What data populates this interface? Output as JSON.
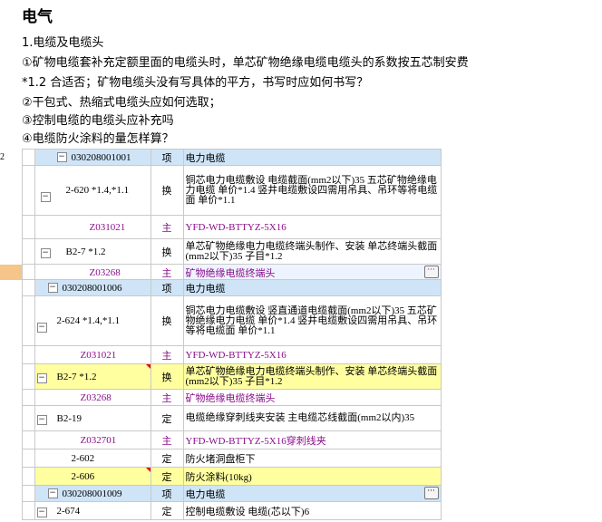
{
  "heading": "电气",
  "lines": [
    "1.电缆及电缆头",
    "①矿物电缆套补充定额里面的电缆头时，单芯矿物绝缘电缆电缆头的系数按五芯制安费",
    "*1.2 合适否；矿物电缆头没有写具体的平方，书写时应如何书写？",
    "②干包式、热缩式电缆头应如何选取；",
    "③控制电缆的电缆头应补充吗",
    "④电缆防火涂料的量怎样算？"
  ],
  "table1": {
    "left_mark": "2",
    "rows": [
      {
        "code": "030208001001",
        "type": "项",
        "desc": "电力电缆"
      },
      {
        "code": "2-620 *1.4,*1.1",
        "type": "换",
        "desc": "铜芯电力电缆敷设 电缆截面(mm2以下)35 五芯矿物绝缘电力电缆 单价*1.4 竖井电缆敷设四需用吊具、吊环等将电缆面 单价*1.1"
      },
      {
        "code": "Z031021",
        "type": "主",
        "desc": "YFD-WD-BTTYZ-5X16"
      },
      {
        "code": "B2-7 *1.2",
        "type": "换",
        "desc": "单芯矿物绝缘电力电缆终端头制作、安装 单芯终端头截面(mm2以下)35 子目*1.2"
      },
      {
        "code": "Z03268",
        "type": "主",
        "desc": "矿物绝缘电缆终端头"
      }
    ]
  },
  "table2": {
    "rows": [
      {
        "code": "030208001006",
        "type": "项",
        "desc": "电力电缆"
      },
      {
        "code": "2-624 *1.4,*1.1",
        "type": "换",
        "desc": "铜芯电力电缆敷设 竖直通道电缆截面(mm2以下)35 五芯矿物绝缘电力电缆 单价*1.4 竖井电缆敷设四需用吊具、吊环等将电缆面 单价*1.1"
      },
      {
        "code": "Z031021",
        "type": "主",
        "desc": "YFD-WD-BTTYZ-5X16"
      },
      {
        "code": "B2-7 *1.2",
        "type": "换",
        "desc": "单芯矿物绝缘电力电缆终端头制作、安装 单芯终端头截面(mm2以下)35 子目*1.2"
      },
      {
        "code": "Z03268",
        "type": "主",
        "desc": "矿物绝缘电缆终端头"
      },
      {
        "code": "B2-19",
        "type": "定",
        "desc": "电缆绝缘穿刺线夹安装 主电缆芯线截面(mm2以内)35"
      },
      {
        "code": "Z032701",
        "type": "主",
        "desc": "YFD-WD-BTTYZ-5X16穿刺线夹"
      },
      {
        "code": "2-602",
        "type": "定",
        "desc": "防火堵洞盘柜下"
      },
      {
        "code": "2-606",
        "type": "定",
        "desc": "防火涂料(10kg)"
      },
      {
        "code": "030208001009",
        "type": "项",
        "desc": "电力电缆"
      },
      {
        "code": "2-674",
        "type": "定",
        "desc": "控制电缆敷设 电缆(芯以下)6"
      }
    ]
  },
  "ellipsis_label": "···",
  "colors": {
    "header_bg": "#cfe4f7",
    "highlight_bg": "#ffffa0",
    "main_material": "#8a0d8a",
    "selection": "#f6c58a"
  }
}
